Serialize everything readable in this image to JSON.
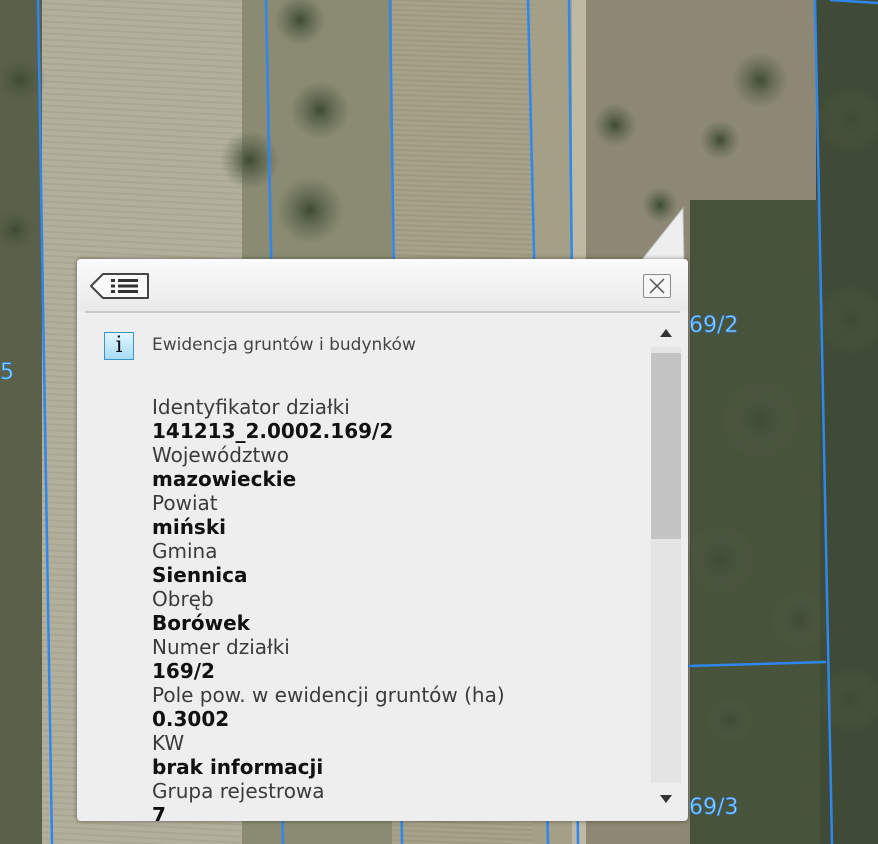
{
  "map": {
    "parcel_labels": [
      "5",
      "69/2",
      "69/3"
    ]
  },
  "popup": {
    "back_icon": "list-back-icon",
    "close_icon": "close-icon",
    "info_icon": "info-icon",
    "info_glyph": "i",
    "layer_title": "Ewidencja gruntów i budynków",
    "attributes": [
      {
        "label": "Identyfikator działki",
        "value": "141213_2.0002.169/2"
      },
      {
        "label": "Województwo",
        "value": "mazowieckie"
      },
      {
        "label": "Powiat",
        "value": "miński"
      },
      {
        "label": "Gmina",
        "value": "Siennica"
      },
      {
        "label": "Obręb",
        "value": "Borówek"
      },
      {
        "label": "Numer działki",
        "value": "169/2"
      },
      {
        "label": "Pole pow. w ewidencji gruntów (ha)",
        "value": "0.3002"
      },
      {
        "label": "KW",
        "value": "brak informacji"
      },
      {
        "label": "Grupa rejestrowa",
        "value": "7"
      }
    ],
    "scroll_up_icon": "triangle-up-icon",
    "scroll_down_icon": "triangle-down-icon",
    "scroll_position": 0.06
  }
}
